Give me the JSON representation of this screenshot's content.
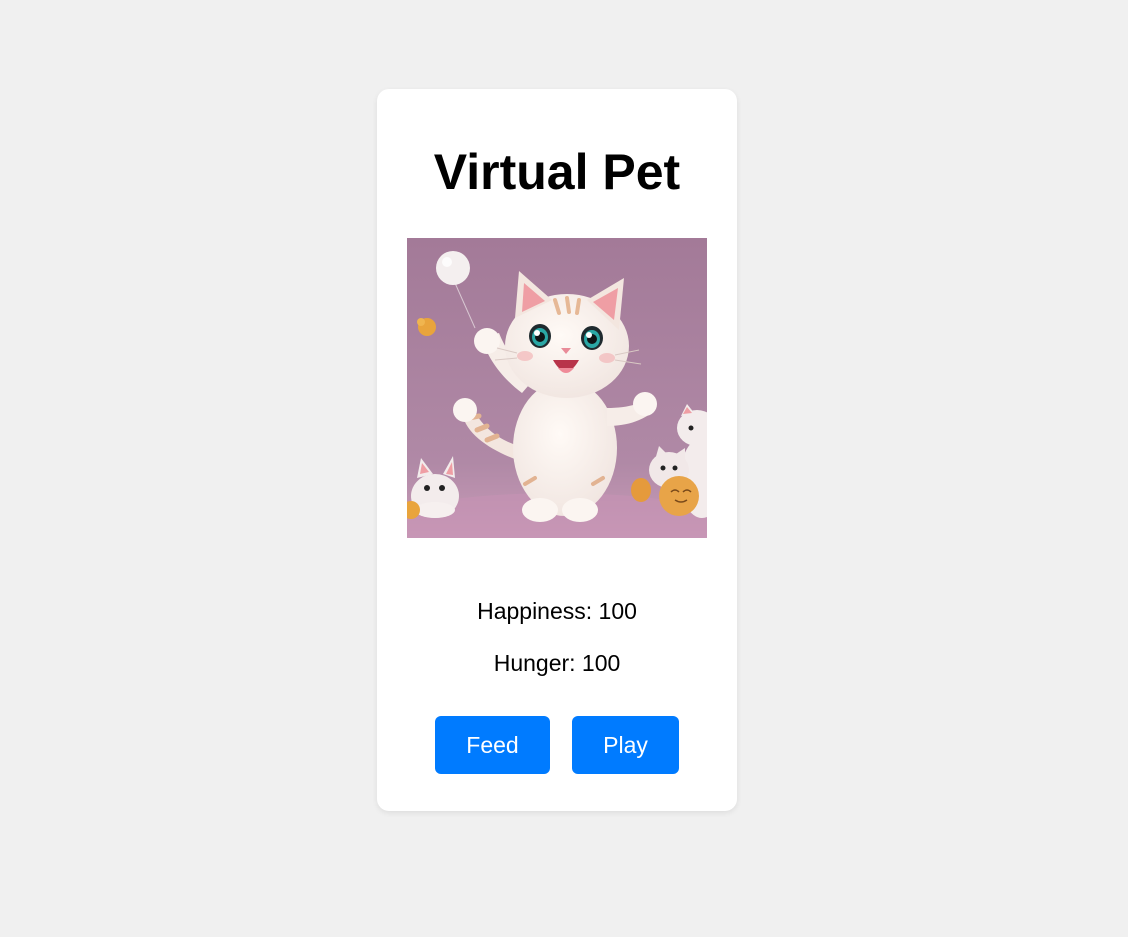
{
  "app": {
    "title": "Virtual Pet"
  },
  "pet": {
    "image_icon": "cartoon-cat-illustration",
    "stats": {
      "happiness_label": "Happiness: 100",
      "hunger_label": "Hunger: 100",
      "happiness": 100,
      "hunger": 100
    }
  },
  "actions": {
    "feed_label": "Feed",
    "play_label": "Play"
  },
  "colors": {
    "page_background": "#f0f0f0",
    "card_background": "#ffffff",
    "button_background": "#007bff",
    "button_text": "#ffffff",
    "image_background": "#a47b98"
  }
}
